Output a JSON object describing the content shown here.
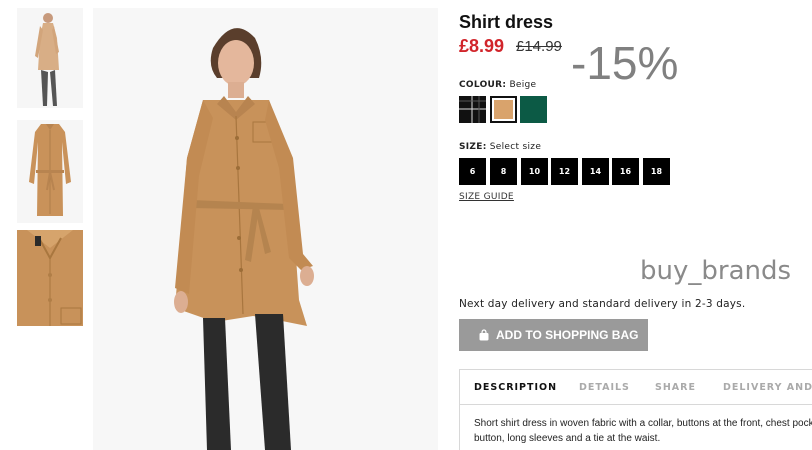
{
  "product": {
    "title": "Shirt dress",
    "price": "£8.99",
    "old_price": "£14.99",
    "discount": "-15%"
  },
  "colour": {
    "label": "COLOUR:",
    "selected": "Beige",
    "swatches": [
      {
        "name": "black-check",
        "color": "#111111"
      },
      {
        "name": "beige",
        "color": "#d9a36c"
      },
      {
        "name": "dark-green",
        "color": "#0c5a45"
      }
    ]
  },
  "size": {
    "label": "SIZE:",
    "placeholder": "Select size",
    "options": [
      "6",
      "8",
      "10",
      "12",
      "14",
      "16",
      "18"
    ],
    "guide": "SIZE GUIDE"
  },
  "watermark": "buy_brands",
  "delivery": "Next day delivery and standard delivery in 2-3 days.",
  "cart": {
    "button_label": "ADD TO SHOPPING BAG",
    "icon": "shopping-bag-icon"
  },
  "tabs": [
    "DESCRIPTION",
    "DETAILS",
    "SHARE",
    "DELIVERY AND P"
  ],
  "description": "Short shirt dress in woven fabric with a collar, buttons at the front, chest pocket with a button, long sleeves and a tie at the waist."
}
